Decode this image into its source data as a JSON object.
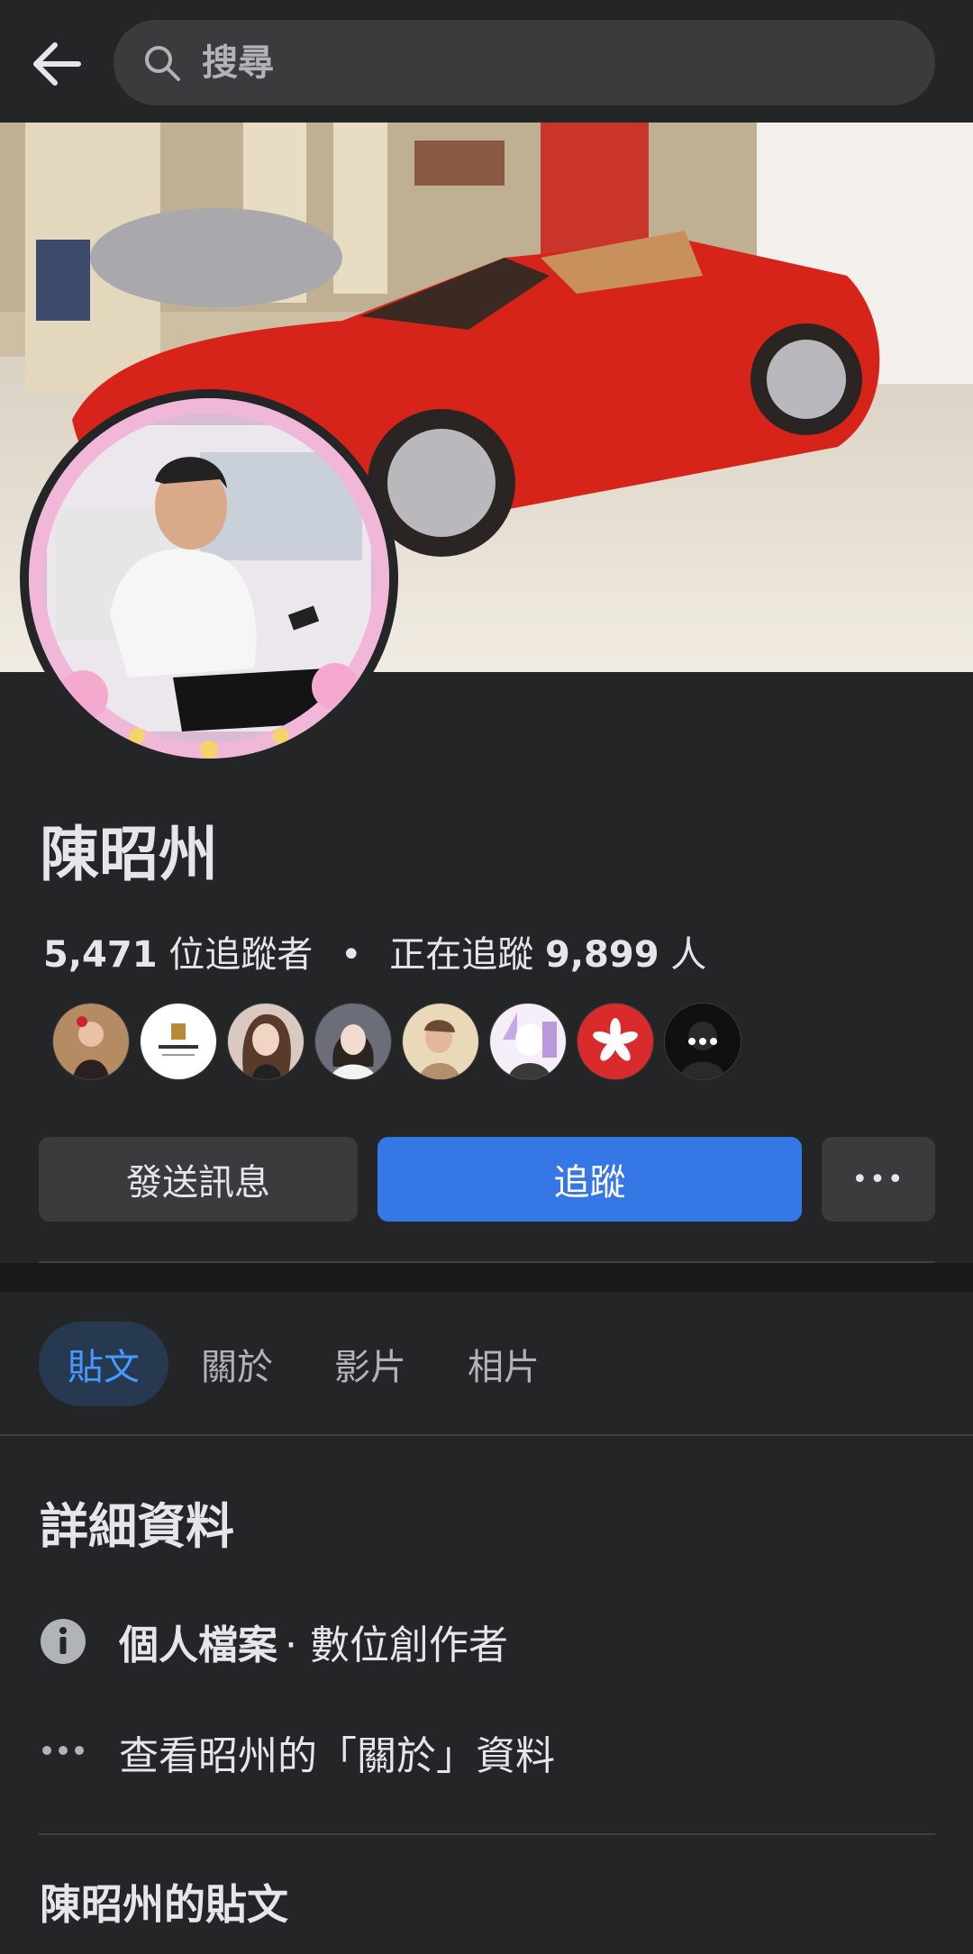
{
  "search": {
    "placeholder": "搜尋"
  },
  "profile": {
    "name": "陳昭州",
    "followers_count": "5,471",
    "followers_label": "位追蹤者",
    "following_label": "正在追蹤",
    "following_count": "9,899",
    "following_unit": "人"
  },
  "actions": {
    "message_label": "發送訊息",
    "follow_label": "追蹤",
    "more_label": "•••"
  },
  "tabs": [
    {
      "label": "貼文",
      "active": true
    },
    {
      "label": "關於",
      "active": false
    },
    {
      "label": "影片",
      "active": false
    },
    {
      "label": "相片",
      "active": false
    }
  ],
  "details": {
    "title": "詳細資料",
    "profile_type": "個人檔案",
    "profile_category": "· 數位創作者",
    "about_link": "查看昭州的「關於」資料"
  },
  "posts_title": "陳昭州的貼文",
  "colors": {
    "background": "#242526",
    "accent": "#3577e5",
    "tab_active": "#4599ff"
  }
}
